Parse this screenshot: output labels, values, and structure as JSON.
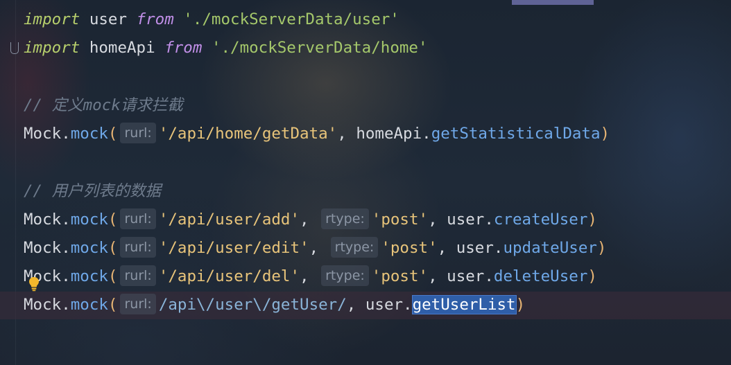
{
  "editor": {
    "lines": [
      {
        "tokens": [
          {
            "t": "import",
            "c": "kw"
          },
          {
            "t": " user ",
            "c": "ident"
          },
          {
            "t": "from",
            "c": "kw2"
          },
          {
            "t": " ",
            "c": "ident"
          },
          {
            "t": "'./mockServerData/user'",
            "c": "str-green"
          }
        ]
      },
      {
        "tokens": [
          {
            "t": "import",
            "c": "kw"
          },
          {
            "t": " homeApi ",
            "c": "ident"
          },
          {
            "t": "from",
            "c": "kw2"
          },
          {
            "t": " ",
            "c": "ident"
          },
          {
            "t": "'./mockServerData/home'",
            "c": "str-green"
          }
        ]
      },
      {
        "tokens": []
      },
      {
        "tokens": [
          {
            "t": "// 定义mock请求拦截",
            "c": "comment"
          }
        ]
      },
      {
        "tokens": [
          {
            "t": "Mock",
            "c": "ident"
          },
          {
            "t": ".",
            "c": "punct"
          },
          {
            "t": "mock",
            "c": "method"
          },
          {
            "t": "(",
            "c": "paren"
          },
          {
            "hint": "rurl:"
          },
          {
            "t": "'/api/home/getData'",
            "c": "str"
          },
          {
            "t": ", ",
            "c": "punct"
          },
          {
            "t": "homeApi",
            "c": "ident"
          },
          {
            "t": ".",
            "c": "punct"
          },
          {
            "t": "getStatisticalData",
            "c": "method"
          },
          {
            "t": ")",
            "c": "paren"
          }
        ]
      },
      {
        "tokens": []
      },
      {
        "tokens": [
          {
            "t": "// 用户列表的数据",
            "c": "comment"
          }
        ]
      },
      {
        "tokens": [
          {
            "t": "Mock",
            "c": "ident"
          },
          {
            "t": ".",
            "c": "punct"
          },
          {
            "t": "mock",
            "c": "method"
          },
          {
            "t": "(",
            "c": "paren"
          },
          {
            "hint": "rurl:"
          },
          {
            "t": "'/api/user/add'",
            "c": "str"
          },
          {
            "t": ", ",
            "c": "punct"
          },
          {
            "hint": "rtype:"
          },
          {
            "t": "'post'",
            "c": "str"
          },
          {
            "t": ", ",
            "c": "punct"
          },
          {
            "t": "user",
            "c": "ident"
          },
          {
            "t": ".",
            "c": "punct"
          },
          {
            "t": "createUser",
            "c": "method"
          },
          {
            "t": ")",
            "c": "paren"
          }
        ]
      },
      {
        "tokens": [
          {
            "t": "Mock",
            "c": "ident"
          },
          {
            "t": ".",
            "c": "punct"
          },
          {
            "t": "mock",
            "c": "method"
          },
          {
            "t": "(",
            "c": "paren"
          },
          {
            "hint": "rurl:"
          },
          {
            "t": "'/api/user/edit'",
            "c": "str"
          },
          {
            "t": ", ",
            "c": "punct"
          },
          {
            "hint": "rtype:"
          },
          {
            "t": "'post'",
            "c": "str"
          },
          {
            "t": ", ",
            "c": "punct"
          },
          {
            "t": "user",
            "c": "ident"
          },
          {
            "t": ".",
            "c": "punct"
          },
          {
            "t": "updateUser",
            "c": "method"
          },
          {
            "t": ")",
            "c": "paren"
          }
        ]
      },
      {
        "tokens": [
          {
            "t": "Mock",
            "c": "ident"
          },
          {
            "t": ".",
            "c": "punct"
          },
          {
            "t": "mock",
            "c": "method"
          },
          {
            "t": "(",
            "c": "paren"
          },
          {
            "hint": "rurl:"
          },
          {
            "t": "'/api/user/del'",
            "c": "str"
          },
          {
            "t": ", ",
            "c": "punct"
          },
          {
            "hint": "rtype:"
          },
          {
            "t": "'post'",
            "c": "str"
          },
          {
            "t": ", ",
            "c": "punct"
          },
          {
            "t": "user",
            "c": "ident"
          },
          {
            "t": ".",
            "c": "punct"
          },
          {
            "t": "deleteUser",
            "c": "method"
          },
          {
            "t": ")",
            "c": "paren"
          }
        ]
      },
      {
        "tokens": [
          {
            "t": "Mock",
            "c": "ident"
          },
          {
            "t": ".",
            "c": "punct"
          },
          {
            "t": "mock",
            "c": "method"
          },
          {
            "t": "(",
            "c": "paren"
          },
          {
            "hint": "rurl:"
          },
          {
            "t": "/api\\/user\\/getUser/",
            "c": "regex"
          },
          {
            "t": ", ",
            "c": "punct"
          },
          {
            "t": "user",
            "c": "ident"
          },
          {
            "t": ".",
            "c": "punct"
          },
          {
            "t": "getUserList",
            "c": "method",
            "selected": true
          },
          {
            "t": ")",
            "c": "paren"
          }
        ]
      }
    ],
    "current_line_index": 10,
    "icons": {
      "fold": "fold-marker-icon",
      "intention": "lightbulb-icon"
    }
  }
}
